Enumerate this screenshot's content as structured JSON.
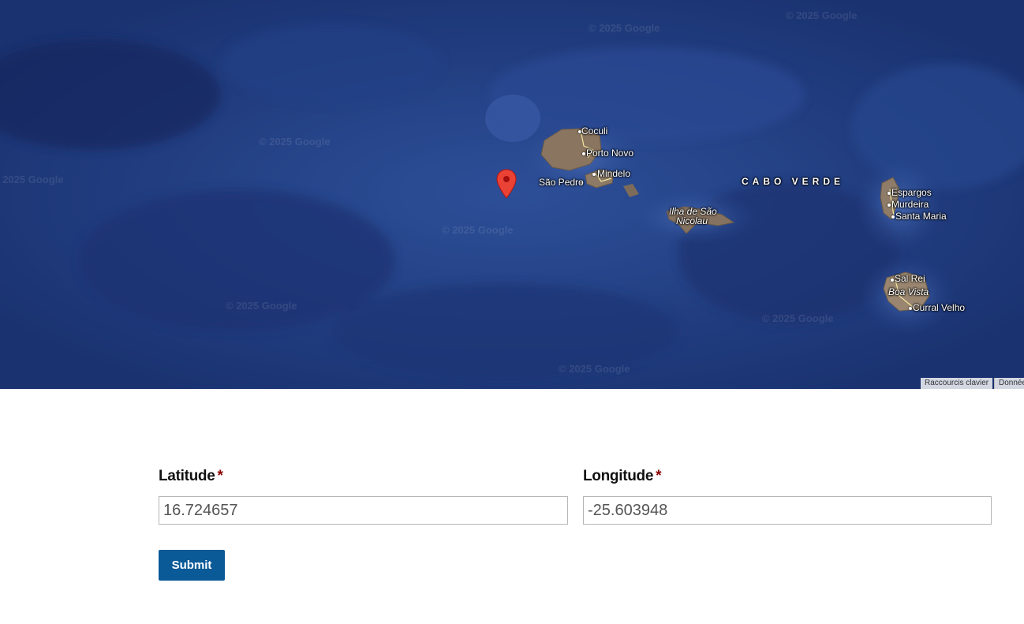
{
  "map": {
    "watermark": "© 2025 Google",
    "places": {
      "coculi": "Coculi",
      "porto_novo": "Porto Novo",
      "mindelo": "Mindelo",
      "sao_pedro": "São Pedro",
      "sao_nicolau_1": "Ilha de São",
      "sao_nicolau_2": "Nicolau",
      "cabo_verde": "CABO VERDE",
      "espargos": "Espargos",
      "murdeira": "Murdeira",
      "santa_maria": "Santa Maria",
      "sal_rei": "Sal Rei",
      "boa_vista": "Boa Vista",
      "curral_velho": "Curral Velho"
    },
    "attribution": {
      "shortcuts": "Raccourcis clavier",
      "data": "Données"
    },
    "marker_color": "#ea4335"
  },
  "form": {
    "latitude": {
      "label": "Latitude",
      "required_mark": "*",
      "value": "16.724657"
    },
    "longitude": {
      "label": "Longitude",
      "required_mark": "*",
      "value": "-25.603948"
    },
    "submit_label": "Submit"
  },
  "colors": {
    "submit_bg": "#0a5a98",
    "required": "#8b0000",
    "ocean": "#1e3a7a"
  }
}
